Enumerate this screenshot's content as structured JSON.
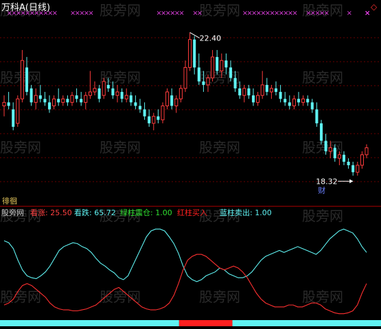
{
  "chart_data": [
    {
      "type": "candlestick",
      "title": "万科A(日线)",
      "annotations": {
        "high_label": "22.40",
        "low_label": "18.32",
        "tag_top_left": "徘徊",
        "tag_bottom": "财",
        "diamond": "◇"
      },
      "ylim": [
        17.6,
        22.9
      ],
      "marker_glyph": "×",
      "markers_top": [
        1,
        2,
        3,
        4,
        5,
        6,
        7,
        8,
        9,
        10,
        11,
        15,
        16,
        17,
        18,
        19,
        34,
        35,
        36,
        37,
        38,
        39,
        42,
        43,
        53,
        54,
        55,
        56,
        57,
        58,
        59,
        60,
        61,
        62,
        63,
        64,
        67,
        68,
        69,
        70,
        71,
        76,
        84,
        85,
        86,
        87,
        88,
        89,
        90,
        91,
        92,
        93
      ],
      "candles": [
        [
          20.3,
          20.6,
          20.0,
          20.4
        ],
        [
          20.4,
          20.7,
          20.2,
          20.3
        ],
        [
          20.2,
          20.4,
          19.6,
          19.7
        ],
        [
          19.8,
          20.6,
          19.7,
          20.5
        ],
        [
          20.5,
          21.9,
          20.4,
          21.6
        ],
        [
          21.4,
          21.7,
          20.6,
          20.7
        ],
        [
          20.8,
          20.9,
          20.3,
          20.4
        ],
        [
          20.4,
          20.8,
          20.2,
          20.6
        ],
        [
          20.6,
          20.9,
          20.4,
          20.5
        ],
        [
          20.5,
          20.7,
          20.3,
          20.4
        ],
        [
          20.4,
          20.6,
          20.1,
          20.2
        ],
        [
          20.3,
          20.6,
          20.2,
          20.5
        ],
        [
          20.5,
          20.8,
          20.3,
          20.4
        ],
        [
          20.4,
          20.6,
          20.3,
          20.5
        ],
        [
          20.5,
          20.6,
          20.3,
          20.4
        ],
        [
          20.4,
          20.7,
          20.3,
          20.6
        ],
        [
          20.6,
          20.8,
          20.4,
          20.5
        ],
        [
          20.5,
          20.7,
          20.3,
          20.4
        ],
        [
          20.4,
          20.7,
          20.2,
          20.6
        ],
        [
          20.6,
          21.3,
          20.5,
          20.7
        ],
        [
          20.7,
          21.0,
          20.6,
          20.8
        ],
        [
          20.8,
          20.9,
          20.4,
          20.5
        ],
        [
          20.6,
          21.1,
          20.5,
          21.0
        ],
        [
          20.9,
          21.1,
          20.7,
          20.8
        ],
        [
          20.8,
          21.0,
          20.5,
          20.6
        ],
        [
          20.6,
          20.9,
          20.4,
          20.7
        ],
        [
          20.7,
          20.8,
          20.4,
          20.5
        ],
        [
          20.5,
          20.8,
          20.4,
          20.6
        ],
        [
          20.6,
          20.7,
          20.3,
          20.4
        ],
        [
          20.4,
          20.6,
          20.2,
          20.3
        ],
        [
          20.3,
          20.5,
          20.1,
          20.2
        ],
        [
          20.2,
          20.4,
          19.9,
          20.0
        ],
        [
          20.0,
          20.2,
          19.7,
          19.8
        ],
        [
          19.8,
          20.1,
          19.6,
          20.0
        ],
        [
          20.0,
          20.2,
          19.8,
          19.9
        ],
        [
          19.9,
          20.4,
          19.8,
          20.3
        ],
        [
          20.3,
          20.8,
          20.2,
          20.7
        ],
        [
          20.6,
          20.8,
          20.2,
          20.3
        ],
        [
          20.3,
          20.6,
          20.1,
          20.5
        ],
        [
          20.5,
          20.9,
          20.4,
          20.8
        ],
        [
          20.8,
          21.6,
          20.7,
          21.4
        ],
        [
          21.4,
          22.4,
          21.3,
          22.2
        ],
        [
          22.2,
          22.3,
          21.2,
          21.4
        ],
        [
          21.4,
          21.8,
          20.9,
          21.0
        ],
        [
          21.0,
          21.3,
          20.7,
          20.9
        ],
        [
          20.9,
          21.2,
          20.7,
          21.1
        ],
        [
          21.1,
          21.9,
          21.0,
          21.7
        ],
        [
          21.7,
          21.9,
          21.2,
          21.3
        ],
        [
          21.3,
          21.8,
          21.1,
          21.6
        ],
        [
          21.6,
          21.8,
          21.2,
          21.4
        ],
        [
          21.4,
          21.6,
          21.0,
          21.1
        ],
        [
          21.1,
          21.3,
          20.7,
          20.8
        ],
        [
          20.8,
          21.0,
          20.5,
          20.6
        ],
        [
          20.6,
          20.9,
          20.4,
          20.8
        ],
        [
          20.8,
          20.9,
          20.5,
          20.6
        ],
        [
          20.6,
          20.8,
          20.3,
          20.4
        ],
        [
          20.4,
          20.7,
          20.3,
          20.6
        ],
        [
          20.6,
          21.3,
          20.5,
          20.9
        ],
        [
          20.9,
          21.1,
          20.6,
          20.7
        ],
        [
          20.7,
          20.9,
          20.5,
          20.8
        ],
        [
          20.8,
          21.0,
          20.6,
          20.7
        ],
        [
          20.7,
          20.9,
          20.4,
          20.5
        ],
        [
          20.5,
          20.7,
          20.3,
          20.4
        ],
        [
          20.4,
          20.6,
          20.2,
          20.3
        ],
        [
          20.3,
          20.6,
          20.2,
          20.5
        ],
        [
          20.5,
          20.7,
          20.3,
          20.4
        ],
        [
          20.4,
          20.6,
          20.3,
          20.5
        ],
        [
          20.5,
          20.6,
          20.3,
          20.4
        ],
        [
          20.4,
          20.5,
          20.1,
          20.2
        ],
        [
          20.2,
          20.4,
          19.7,
          19.8
        ],
        [
          19.8,
          19.9,
          19.2,
          19.3
        ],
        [
          19.3,
          19.5,
          18.9,
          19.0
        ],
        [
          19.0,
          19.3,
          18.8,
          19.1
        ],
        [
          19.1,
          19.2,
          18.7,
          18.8
        ],
        [
          18.8,
          19.0,
          18.6,
          18.9
        ],
        [
          18.9,
          19.0,
          18.6,
          18.7
        ],
        [
          18.7,
          18.8,
          18.5,
          18.6
        ],
        [
          18.6,
          18.7,
          18.3,
          18.4
        ],
        [
          18.4,
          18.7,
          18.3,
          18.6
        ],
        [
          18.6,
          19.0,
          18.5,
          18.9
        ],
        [
          18.9,
          19.2,
          18.8,
          19.1
        ]
      ]
    },
    {
      "type": "line",
      "legend": [
        {
          "label": "股旁网",
          "color": "#c0c0c0"
        },
        {
          "label": "看涨: 25.50",
          "color": "#ff4040"
        },
        {
          "label": "看跌: 65.72",
          "color": "#5ff2f2"
        },
        {
          "label": "绿柱震仓: 1.00",
          "color": "#30e030"
        },
        {
          "label": "红柱买入",
          "color": "#ff2020"
        },
        {
          "label": "蓝柱卖出: 1.00",
          "color": "#5ff2f2"
        }
      ],
      "ylim": [
        0,
        100
      ],
      "series": [
        {
          "name": "看跌",
          "color": "#5ff2f2",
          "values": [
            78,
            76,
            70,
            58,
            48,
            42,
            40,
            39,
            42,
            46,
            52,
            60,
            68,
            72,
            74,
            76,
            75,
            72,
            70,
            66,
            60,
            55,
            52,
            48,
            45,
            40,
            38,
            42,
            52,
            62,
            72,
            82,
            88,
            90,
            90,
            88,
            82,
            75,
            65,
            52,
            42,
            38,
            36,
            38,
            42,
            44,
            46,
            50,
            48,
            44,
            42,
            40,
            40,
            42,
            46,
            52,
            58,
            62,
            64,
            66,
            68,
            66,
            68,
            70,
            72,
            70,
            68,
            66,
            64,
            68,
            74,
            80,
            84,
            88,
            90,
            88,
            86,
            80,
            72,
            66
          ]
        },
        {
          "name": "看涨",
          "color": "#ff3030",
          "values": [
            12,
            14,
            18,
            26,
            32,
            34,
            32,
            28,
            24,
            20,
            14,
            10,
            8,
            7,
            7,
            6,
            6,
            7,
            8,
            10,
            12,
            16,
            20,
            24,
            28,
            30,
            26,
            22,
            18,
            14,
            10,
            8,
            7,
            7,
            8,
            10,
            14,
            22,
            34,
            48,
            58,
            62,
            64,
            64,
            62,
            58,
            54,
            50,
            48,
            50,
            52,
            50,
            46,
            40,
            32,
            24,
            18,
            14,
            12,
            10,
            10,
            10,
            12,
            12,
            10,
            10,
            12,
            14,
            14,
            12,
            8,
            6,
            4,
            3,
            3,
            4,
            6,
            12,
            24,
            34
          ]
        }
      ]
    }
  ],
  "footer_bars": [
    {
      "start": 0,
      "end": 0.47,
      "color": "#5ff2f2"
    },
    {
      "start": 0.47,
      "end": 0.61,
      "color": "#ff2020"
    },
    {
      "start": 0.61,
      "end": 1,
      "color": "#5ff2f2"
    }
  ],
  "watermarks": {
    "text": "股旁网"
  }
}
